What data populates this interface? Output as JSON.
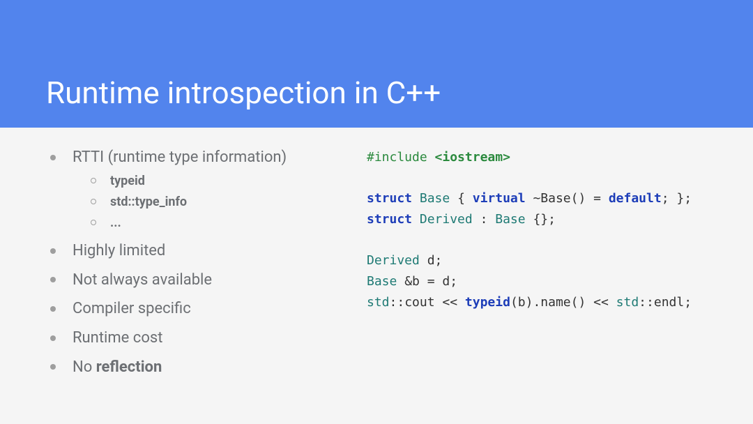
{
  "title": "Runtime introspection in C++",
  "bullets": {
    "b0": {
      "text": "RTTI (runtime type information)",
      "sub": {
        "s0": "typeid",
        "s1": "std::type_info",
        "s2": "..."
      }
    },
    "b1": "Highly limited",
    "b2": "Not always available",
    "b3": "Compiler specific",
    "b4": "Runtime cost",
    "b5_pre": "No ",
    "b5_bold": "reflection"
  },
  "code": {
    "pp": "#include",
    "inc": "<iostream>",
    "kw_struct": "struct",
    "t_Base": "Base",
    "brace_open_sp": " { ",
    "kw_virtual": "virtual",
    "dtor": " ~Base() = ",
    "kw_default": "default",
    "tail1": "; };",
    "t_Derived": "Derived",
    "colon_base": " : ",
    "empty_body": " {};",
    "decl_d": " d;",
    "amp_b": " &b = d;",
    "ns_std": "std",
    "scope": "::",
    "cout": "cout << ",
    "kw_typeid": "typeid",
    "typeid_tail": "(b).name() << ",
    "endl": "endl;"
  }
}
